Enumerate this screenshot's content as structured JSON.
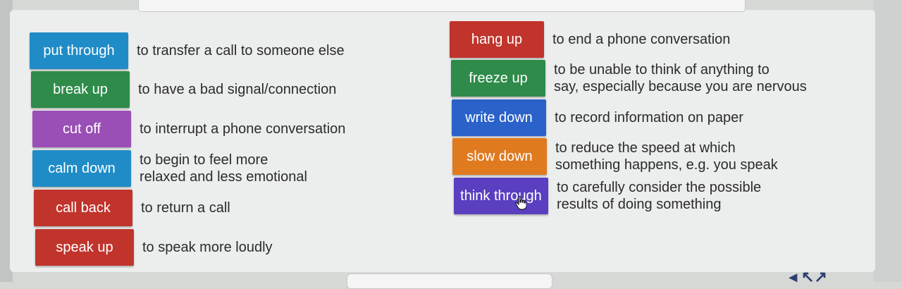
{
  "left_column": [
    {
      "term": "put through",
      "definition": [
        "to transfer a call to someone else"
      ],
      "color": "#1f8cc7"
    },
    {
      "term": "break up",
      "definition": [
        "to have a bad signal/connection"
      ],
      "color": "#2e8b4a"
    },
    {
      "term": "cut off",
      "definition": [
        "to interrupt a phone conversation"
      ],
      "color": "#9a4fb6"
    },
    {
      "term": "calm down",
      "definition": [
        "to begin to feel more",
        "relaxed and less emotional"
      ],
      "color": "#1f8cc7"
    },
    {
      "term": "call back",
      "definition": [
        "to return a call"
      ],
      "color": "#c0342c"
    },
    {
      "term": "speak up",
      "definition": [
        "to speak more loudly"
      ],
      "color": "#c0342c"
    }
  ],
  "right_column": [
    {
      "term": "hang up",
      "definition": [
        "to end a phone conversation"
      ],
      "color": "#c0342c"
    },
    {
      "term": "freeze up",
      "definition": [
        "to be unable to think of anything to",
        "say, especially because you are nervous"
      ],
      "color": "#2e8b4a"
    },
    {
      "term": "write down",
      "definition": [
        "to record information on paper"
      ],
      "color": "#2a62c9"
    },
    {
      "term": "slow down",
      "definition": [
        "to reduce the speed at which",
        "something happens, e.g. you speak"
      ],
      "color": "#e07a1f"
    },
    {
      "term": "think through",
      "definition": [
        "to carefully consider the possible",
        "results of doing something"
      ],
      "color": "#5a3fc0"
    }
  ]
}
